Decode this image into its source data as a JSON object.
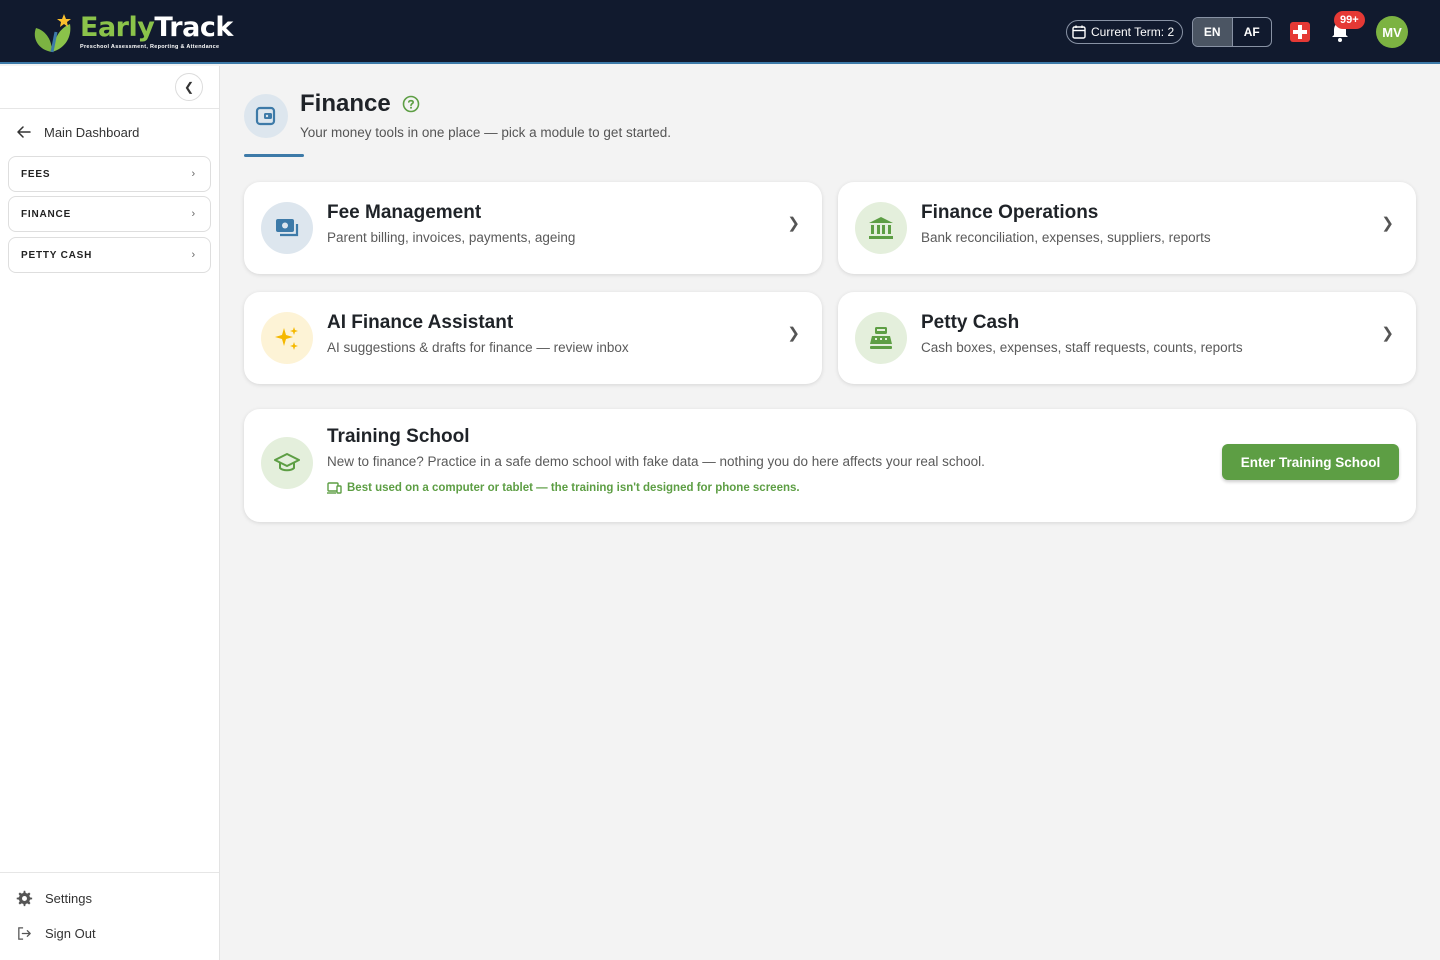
{
  "app": {
    "brand_early": "Early",
    "brand_track": "Track",
    "tagline": "Preschool Assessment, Reporting & Attendance"
  },
  "topbar": {
    "term_label": "Current Term: 2",
    "languages": [
      "EN",
      "AF"
    ],
    "active_language": "EN",
    "notification_count": "99+",
    "avatar_initials": "MV"
  },
  "sidebar": {
    "back_label": "Main Dashboard",
    "items": [
      {
        "label": "FEES"
      },
      {
        "label": "FINANCE"
      },
      {
        "label": "PETTY CASH"
      }
    ],
    "settings_label": "Settings",
    "signout_label": "Sign Out"
  },
  "page": {
    "title": "Finance",
    "subtitle": "Your money tools in one place — pick a module to get started."
  },
  "cards": [
    {
      "title": "Fee Management",
      "desc": "Parent billing, invoices, payments, ageing",
      "icon": "money-icon"
    },
    {
      "title": "Finance Operations",
      "desc": "Bank reconciliation, expenses, suppliers, reports",
      "icon": "bank-icon"
    },
    {
      "title": "AI Finance Assistant",
      "desc": "AI suggestions & drafts for finance — review inbox",
      "icon": "sparkle-icon"
    },
    {
      "title": "Petty Cash",
      "desc": "Cash boxes, expenses, staff requests, counts, reports",
      "icon": "cash-register-icon"
    }
  ],
  "training": {
    "title": "Training School",
    "desc": "New to finance? Practice in a safe demo school with fake data — nothing you do here affects your real school.",
    "note": "Best used on a computer or tablet — the training isn't designed for phone screens.",
    "button_label": "Enter Training School"
  },
  "colors": {
    "topbar_bg": "#111a2e",
    "accent_blue": "#3d7aa8",
    "accent_green": "#5d9e44",
    "badge_red": "#e53935"
  }
}
